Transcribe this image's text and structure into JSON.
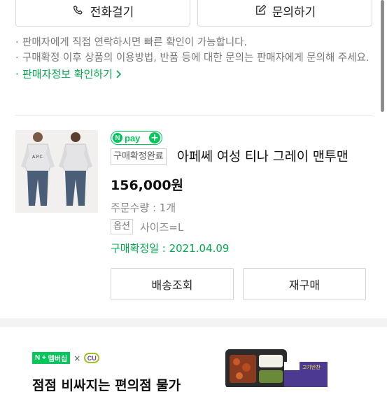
{
  "contact": {
    "call_label": "전화걸기",
    "inquiry_label": "문의하기"
  },
  "notes": [
    "판매자에게 직접 연락하시면 빠른 확인이 가능합니다.",
    "구매확정 이후 상품의 이용방법, 반품 등에 대한 문의는 판매자에게 문의해 주세요."
  ],
  "seller_info_link": "판매자정보 확인하기",
  "order": {
    "npay_text": "pay",
    "npay_n": "N",
    "status": "구매확정완료",
    "product_name": "아페쎄 여성 티나 그레이 맨투맨",
    "price": "156,000원",
    "quantity": "주문수량 : 1개",
    "option_badge": "옵션",
    "option_value": "사이즈=L",
    "confirm_date": "구매확정일 : 2021.04.09",
    "buttons": {
      "tracking": "배송조회",
      "reorder": "재구매"
    }
  },
  "ad": {
    "membership": "멤버십",
    "cu": "CU",
    "headline": "점점 비싸지는 편의점 물가",
    "package_label": "고기반찬"
  },
  "colors": {
    "accent_green": "#03c75a",
    "link_green": "#03a94d"
  }
}
